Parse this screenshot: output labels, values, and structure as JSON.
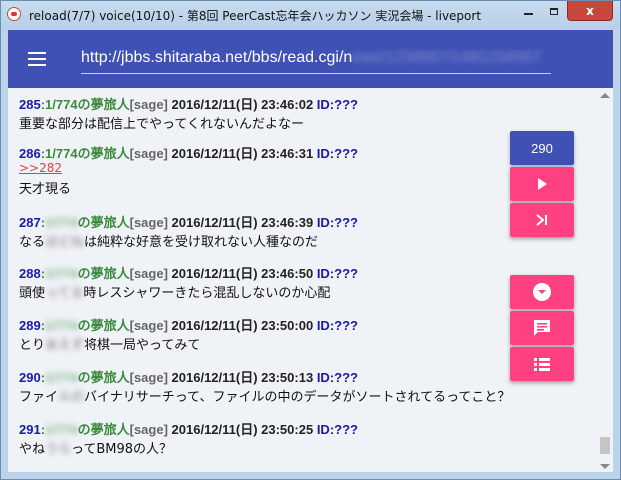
{
  "window": {
    "title": "reload(7/7) voice(10/10) - 第8回 PeerCast忘年会ハッカソン 実況会場 - liveport",
    "close_label": "x"
  },
  "appbar": {
    "url_visible": "http://jbbs.shitaraba.net/bbs/read.cgi/n",
    "url_blurred": "ews/1234567/1481234567"
  },
  "counter": {
    "value": "290"
  },
  "colors": {
    "appbar": "#3f51b5",
    "fab": "#ff4081",
    "post_number": "#1a1aa6",
    "name": "#3b8a3b",
    "anchor": "#e04040"
  },
  "icons": [
    "menu-icon",
    "play-icon",
    "skip-to-end-icon",
    "scroll-down-icon",
    "comment-icon",
    "list-icon"
  ],
  "posts": [
    {
      "num": "285",
      "pos": ":1/774",
      "name": "の夢旅人",
      "sage": "[sage]",
      "date": "2016/12/11(日) 23:46:02",
      "id": "ID:???",
      "text_a": "重要な部分は配信上でやってくれないんだよなー",
      "text_blur": "",
      "text_b": ""
    },
    {
      "num": "286",
      "pos": ":1/774",
      "name": "の夢旅人",
      "sage": "[sage]",
      "date": "2016/12/11(日) 23:46:31",
      "id": "ID:???",
      "anchor": ">>282",
      "text_a": "天才現る",
      "text_blur": "",
      "text_b": ""
    },
    {
      "num": "287",
      "pos": ":",
      "pos_blur": "1/774",
      "name": "の夢旅人",
      "sage": "[sage]",
      "date": "2016/12/11(日) 23:46:39",
      "id": "ID:???",
      "text_a": "なる",
      "text_blur": "ほどね",
      "text_b": "は純粋な好意を受け取れない人種なのだ"
    },
    {
      "num": "288",
      "pos": ":",
      "pos_blur": "1/774",
      "name": "の夢旅人",
      "sage": "[sage]",
      "date": "2016/12/11(日) 23:46:50",
      "id": "ID:???",
      "text_a": "頭使",
      "text_blur": "ってる",
      "text_b": "時レスシャワーきたら混乱しないのか心配"
    },
    {
      "num": "289",
      "pos": ":",
      "pos_blur": "1/774",
      "name": "の夢旅人",
      "sage": "[sage]",
      "date": "2016/12/11(日) 23:50:00",
      "id": "ID:???",
      "text_a": "とり",
      "text_blur": "あえず",
      "text_b": "将棋一局やってみて"
    },
    {
      "num": "290",
      "pos": ":",
      "pos_blur": "1/774",
      "name": "の夢旅人",
      "sage": "[sage]",
      "date": "2016/12/11(日) 23:50:13",
      "id": "ID:???",
      "text_a": "ファイ",
      "text_blur": "ルの",
      "text_b": "バイナリサーチって、ファイルの中のデータがソートされてるってこと？"
    },
    {
      "num": "291",
      "pos": ":",
      "pos_blur": "1/774",
      "name": "の夢旅人",
      "sage": "[sage]",
      "date": "2016/12/11(日) 23:50:25",
      "id": "ID:???",
      "text_a": "やね",
      "text_blur": "うら",
      "text_b": "ってBM98の人？"
    }
  ]
}
